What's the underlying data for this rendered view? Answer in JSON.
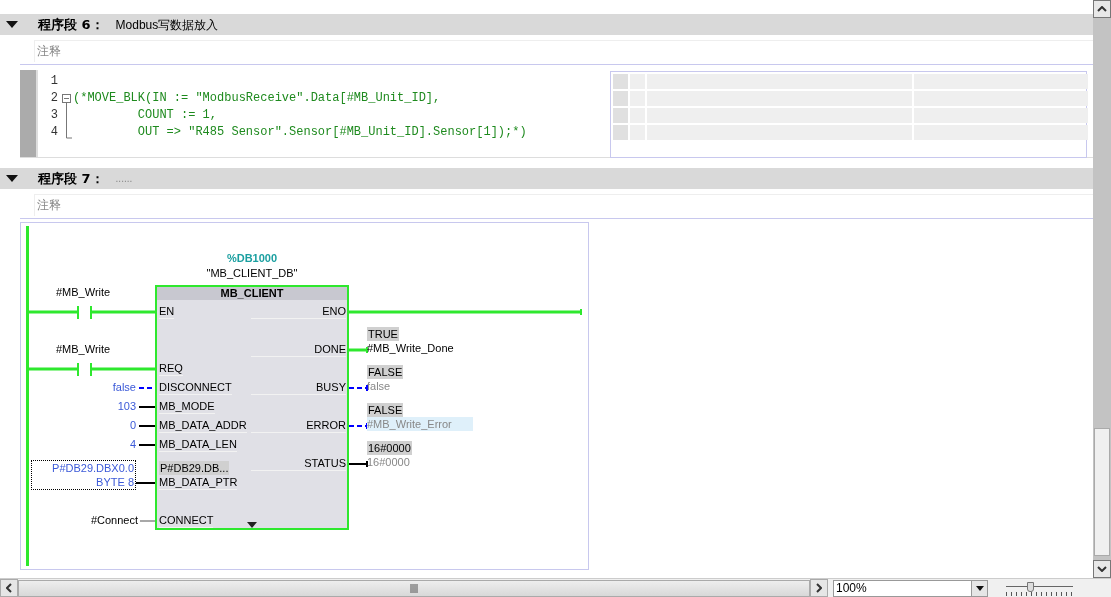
{
  "networks": [
    {
      "label": "程序段 6：",
      "title": "Modbus写数据放入",
      "expanded": true,
      "comment": {
        "placeholder": "注释"
      },
      "scl_code": [
        {
          "number": "1",
          "kind": "plain"
        },
        {
          "number": "2",
          "text": "(*MOVE_BLK(IN := \"ModbusReceive\".Data[#MB_Unit_ID],",
          "kind": "foldstart"
        },
        {
          "number": "3",
          "text": "         COUNT := 1,",
          "kind": "foldinside"
        },
        {
          "number": "4",
          "text": "         OUT => \"R485 Sensor\".Sensor[#MB_Unit_ID].Sensor[1]);*)",
          "kind": "foldend"
        }
      ]
    },
    {
      "label": "程序段 7：",
      "title": "......",
      "expanded": true,
      "comment": {
        "placeholder": "注释"
      },
      "ladder": {
        "instance_address": "%DB1000",
        "instance_name": "\"MB_CLIENT_DB\"",
        "block_type": "MB_CLIENT",
        "inputs": [
          {
            "pin": "EN",
            "kind": "powered",
            "operand": {
              "kind": "contact",
              "lines": [
                "#MB_Write"
              ]
            }
          },
          {
            "pin": "REQ",
            "kind": "powered",
            "operand": {
              "kind": "contact",
              "lines": [
                "#MB_Write"
              ]
            }
          },
          {
            "pin": "DISCONNECT",
            "kind": "dashed",
            "operand": {
              "kind": "constant",
              "lines": [
                "false"
              ]
            }
          },
          {
            "pin": "MB_MODE",
            "kind": "value",
            "operand": {
              "kind": "constant",
              "lines": [
                "103"
              ]
            }
          },
          {
            "pin": "MB_DATA_ADDR",
            "kind": "value",
            "operand": {
              "kind": "constant",
              "lines": [
                "0"
              ]
            }
          },
          {
            "pin": "MB_DATA_LEN",
            "kind": "value",
            "operand": {
              "kind": "constant",
              "lines": [
                "4"
              ]
            }
          },
          {
            "pin": "MB_DATA_PTR",
            "kind": "value",
            "monitor": "P#DB29.DB...",
            "operand": {
              "kind": "pointer",
              "lines": [
                "P#DB29.DBX0.0",
                "BYTE 8"
              ]
            }
          },
          {
            "pin": "CONNECT",
            "kind": "inactive",
            "operand": {
              "kind": "variable",
              "lines": [
                "#Connect"
              ]
            }
          }
        ],
        "outputs": [
          {
            "pin": "ENO",
            "kind": "powered",
            "selected": false,
            "dimmed": false
          },
          {
            "pin": "DONE",
            "kind": "powered",
            "monitor": "TRUE",
            "operand": "#MB_Write_Done",
            "selected": false,
            "dimmed": false
          },
          {
            "pin": "BUSY",
            "kind": "dashed",
            "monitor": "FALSE",
            "operand": "false",
            "selected": false,
            "dimmed": true
          },
          {
            "pin": "ERROR",
            "kind": "dashed",
            "monitor": "FALSE",
            "operand": "#MB_Write_Error",
            "selected": true,
            "dimmed": true
          },
          {
            "pin": "STATUS",
            "kind": "value",
            "monitor": "16#0000",
            "operand": "16#0000",
            "selected": false,
            "dimmed": true
          }
        ]
      }
    }
  ],
  "zoom": {
    "value": "100%"
  },
  "zoom_slider": {
    "level": 0.36
  }
}
